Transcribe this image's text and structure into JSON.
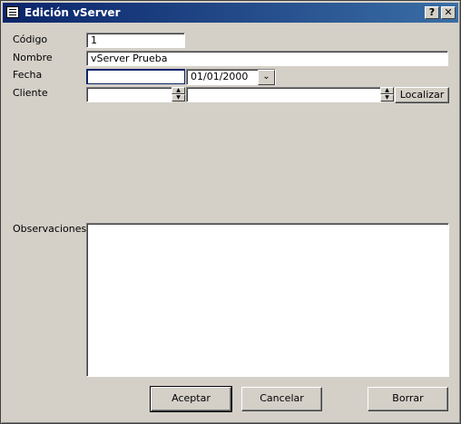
{
  "window": {
    "title": "Edición vServer",
    "help_btn": "?",
    "close_btn": "✕"
  },
  "form": {
    "codigo_label": "Código",
    "codigo_value": "1",
    "nombre_label": "Nombre",
    "nombre_value": "vServer Prueba",
    "fecha_label": "Fecha",
    "fecha_value": "",
    "fecha_date": "01/01/2000",
    "cliente_label": "Cliente",
    "cliente_code": "",
    "cliente_name": "",
    "localizar_label": "Localizar",
    "observaciones_label": "Observaciones",
    "observaciones_value": ""
  },
  "buttons": {
    "aceptar": "Aceptar",
    "cancelar": "Cancelar",
    "borrar": "Borrar"
  }
}
